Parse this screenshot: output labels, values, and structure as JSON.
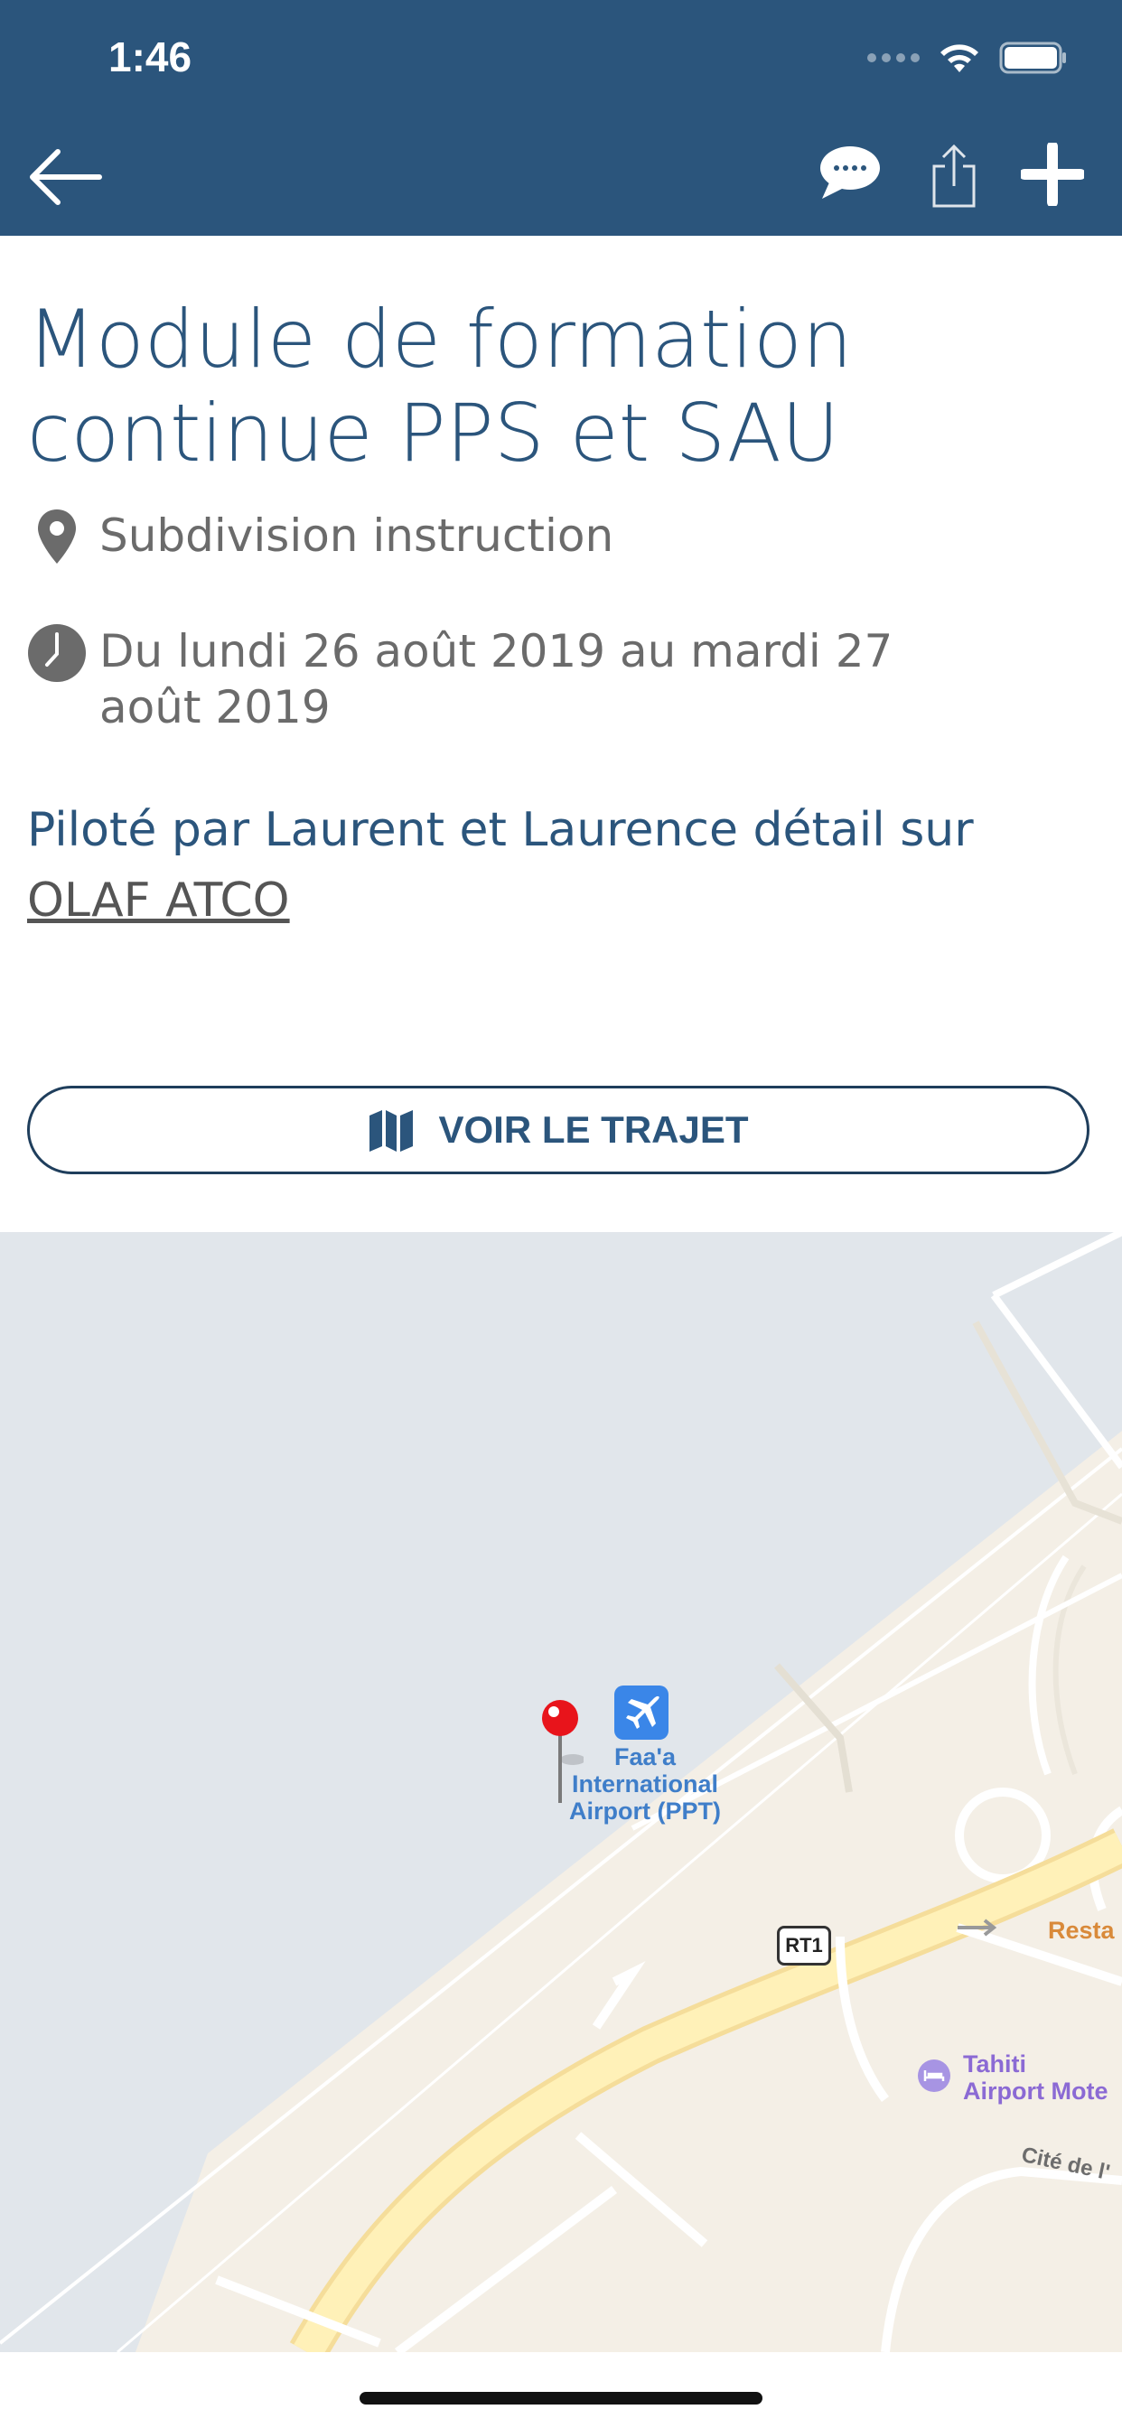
{
  "status_bar": {
    "time": "1:46"
  },
  "header": {
    "back_icon": "arrow-left-icon",
    "chat_icon": "chat-bubble-icon",
    "share_icon": "share-icon",
    "add_icon": "plus-icon",
    "background": "#2b557c"
  },
  "event": {
    "title": "Module de formation continue PPS et SAU",
    "location": "Subdivision instruction",
    "date": "Du lundi 26 août 2019 au mardi 27 août 2019",
    "description_prefix": "Piloté par Laurent et Laurence détail sur ",
    "description_link": "OLAF ATCO"
  },
  "route_button": {
    "label": "VOIR LE TRAJET",
    "icon": "map-icon"
  },
  "map": {
    "airport_name": "Faa'a International Airport (PPT)",
    "airport_line1": "Faa'a",
    "airport_line2": "International",
    "airport_line3": "Airport (PPT)",
    "road_label": "RT1",
    "restaurant_label": "Resta",
    "hotel_line1": "Tahiti",
    "hotel_line2": "Airport Mote",
    "street_label": "Cité de l'",
    "pin_color": "#e8141b"
  }
}
